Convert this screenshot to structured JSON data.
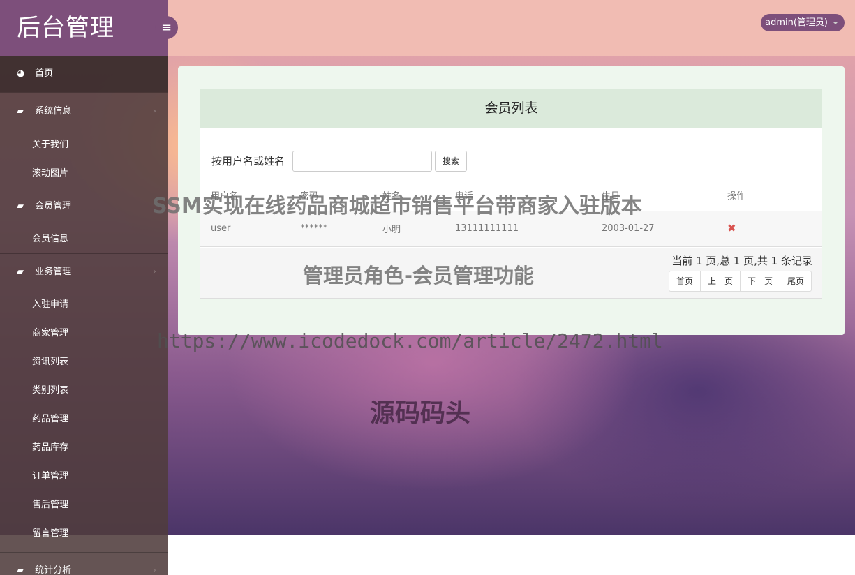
{
  "app": {
    "title": "后台管理",
    "menu_toggle_icon": "≡"
  },
  "header": {
    "user_label": "admin(管理员)"
  },
  "sidebar": {
    "home": {
      "label": "首页",
      "icon": "dashboard-icon"
    },
    "groups": [
      {
        "label": "系统信息",
        "icon": "book-icon",
        "items": [
          "关于我们",
          "滚动图片"
        ]
      },
      {
        "label": "会员管理",
        "icon": "book-icon",
        "items": [
          "会员信息"
        ]
      },
      {
        "label": "业务管理",
        "icon": "book-icon",
        "items": [
          "入驻申请",
          "商家管理",
          "资讯列表",
          "类别列表",
          "药品管理",
          "药品库存",
          "订单管理",
          "售后管理",
          "留言管理"
        ]
      },
      {
        "label": "统计分析",
        "icon": "book-icon",
        "items": []
      }
    ]
  },
  "main": {
    "card_title": "会员列表",
    "search": {
      "label": "按用户名或姓名",
      "value": "",
      "button": "搜索"
    },
    "table": {
      "headers": [
        "用户名",
        "密码",
        "姓名",
        "电话",
        "生日",
        "操作"
      ],
      "rows": [
        [
          "user",
          "******",
          "小明",
          "13111111111",
          "2003-01-27",
          "✖"
        ]
      ]
    },
    "pager": {
      "info": "当前 1 页,总 1 页,共 1 条记录",
      "buttons": [
        "首页",
        "上一页",
        "下一页",
        "尾页"
      ]
    }
  },
  "watermarks": {
    "w1": "SSM实现在线药品商城超市销售平台带商家入驻版本",
    "w2": "管理员角色-会员管理功能",
    "w3": "https://www.icodedock.com/article/2472.html",
    "w4": "源码码头"
  },
  "colors": {
    "sidebar_accent": "#7d4f7b",
    "header": "#f1bcb3",
    "delete": "#d9534f"
  }
}
